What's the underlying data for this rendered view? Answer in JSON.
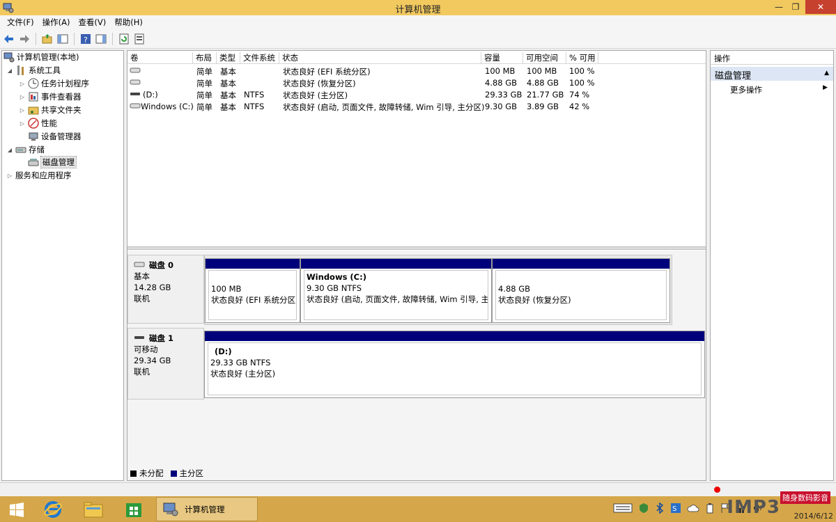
{
  "window": {
    "title": "计算机管理",
    "ctrl_min": "—",
    "ctrl_max": "❐",
    "ctrl_close": "✕"
  },
  "menu": [
    "文件(F)",
    "操作(A)",
    "查看(V)",
    "帮助(H)"
  ],
  "tree": {
    "root": "计算机管理(本地)",
    "system_tools": "系统工具",
    "task_scheduler": "任务计划程序",
    "event_viewer": "事件查看器",
    "shared_folders": "共享文件夹",
    "performance": "性能",
    "device_manager": "设备管理器",
    "storage": "存储",
    "disk_management": "磁盘管理",
    "services_apps": "服务和应用程序"
  },
  "volume_list": {
    "columns": [
      "卷",
      "布局",
      "类型",
      "文件系统",
      "状态",
      "容量",
      "可用空间",
      "% 可用"
    ],
    "rows": [
      {
        "volume": "",
        "layout": "简单",
        "type": "基本",
        "fs": "",
        "status": "状态良好 (EFI 系统分区)",
        "capacity": "100 MB",
        "free": "100 MB",
        "pct": "100 %"
      },
      {
        "volume": "",
        "layout": "简单",
        "type": "基本",
        "fs": "",
        "status": "状态良好 (恢复分区)",
        "capacity": "4.88 GB",
        "free": "4.88 GB",
        "pct": "100 %"
      },
      {
        "volume": "(D:)",
        "layout": "简单",
        "type": "基本",
        "fs": "NTFS",
        "status": "状态良好 (主分区)",
        "capacity": "29.33 GB",
        "free": "21.77 GB",
        "pct": "74 %"
      },
      {
        "volume": "Windows (C:)",
        "layout": "简单",
        "type": "基本",
        "fs": "NTFS",
        "status": "状态良好 (启动, 页面文件, 故障转储, Wim 引导, 主分区)",
        "capacity": "9.30 GB",
        "free": "3.89 GB",
        "pct": "42 %"
      }
    ]
  },
  "disks": [
    {
      "name": "磁盘 0",
      "kind": "基本",
      "size": "14.28 GB",
      "state": "联机",
      "partitions": [
        {
          "title": "",
          "line1": "100 MB",
          "line2": "状态良好 (EFI 系统分区)"
        },
        {
          "title": "Windows  (C:)",
          "line1": "9.30 GB NTFS",
          "line2": "状态良好 (启动, 页面文件, 故障转储, Wim 引导, 主分"
        },
        {
          "title": "",
          "line1": "4.88 GB",
          "line2": "状态良好 (恢复分区)"
        }
      ]
    },
    {
      "name": "磁盘 1",
      "kind": "可移动",
      "size": "29.34 GB",
      "state": "联机",
      "partitions": [
        {
          "title": "(D:)",
          "line1": "29.33 GB NTFS",
          "line2": "状态良好 (主分区)"
        }
      ]
    }
  ],
  "legend": {
    "unallocated": "未分配",
    "primary": "主分区"
  },
  "actions": {
    "header": "操作",
    "section": "磁盘管理",
    "more": "更多操作"
  },
  "taskbar": {
    "app_label": "计算机管理",
    "date": "2014/6/12",
    "watermark": "IMP3",
    "tag": "随身数码影音"
  },
  "colors": {
    "title_bar": "#f1c95f",
    "taskbar": "#d6a74a",
    "primary_partition": "#00007a",
    "action_section": "#dce6f4"
  }
}
